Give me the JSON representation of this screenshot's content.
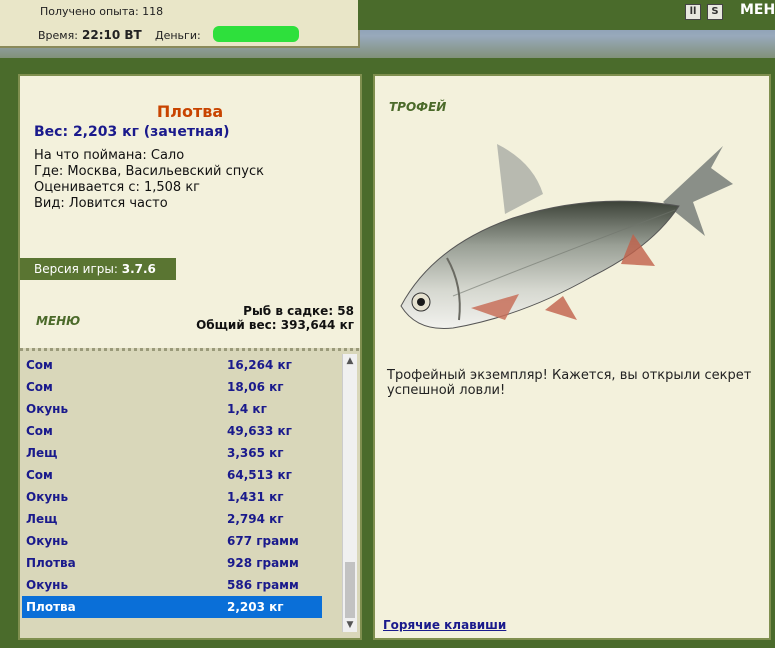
{
  "status": {
    "exp_text": "Получено опыта: 118",
    "time_label": "Время:",
    "time_value": "22:10 ВТ",
    "money_label": "Деньги:"
  },
  "topbar": {
    "menu_label": "МЕНЮ",
    "pause_icon": "pause-icon",
    "sound_icon": "sound-icon"
  },
  "catch": {
    "name": "Плотва",
    "weight": "Вес: 2,203 кг (зачетная)",
    "bait": "На что поймана: Сало",
    "place": "Где: Москва, Васильевский спуск",
    "estimate": "Оценивается с: 1,508 кг",
    "kind": "Вид: Ловится часто"
  },
  "version": {
    "label": "Версия игры:",
    "value": "3.7.6"
  },
  "menu_label": "МЕНЮ",
  "keepnet": {
    "count": "Рыб в садке: 58",
    "total": "Общий вес: 393,644 кг"
  },
  "fish_list": [
    {
      "name": "Сом",
      "weight": "16,264 кг"
    },
    {
      "name": "Сом",
      "weight": "18,06 кг"
    },
    {
      "name": "Окунь",
      "weight": "1,4 кг"
    },
    {
      "name": "Сом",
      "weight": "49,633 кг"
    },
    {
      "name": "Лещ",
      "weight": "3,365 кг"
    },
    {
      "name": "Сом",
      "weight": "64,513 кг"
    },
    {
      "name": "Окунь",
      "weight": "1,431 кг"
    },
    {
      "name": "Лещ",
      "weight": "2,794 кг"
    },
    {
      "name": "Окунь",
      "weight": "677 грамм"
    },
    {
      "name": "Плотва",
      "weight": "928 грамм"
    },
    {
      "name": "Окунь",
      "weight": "586 грамм"
    },
    {
      "name": "Плотва",
      "weight": "2,203 кг"
    }
  ],
  "selected_index": 11,
  "trophy": {
    "title": "ТРОФЕЙ",
    "description": "Трофейный экземпляр! Кажется, вы открыли секрет успешной ловли!",
    "hotkeys": "Горячие клавиши"
  },
  "colors": {
    "frame_green": "#4a6b2b",
    "panel_bg": "#f3f1dc",
    "selection": "#0a6fd8",
    "fish_name": "#c84400",
    "list_text": "#1a1a8c"
  }
}
